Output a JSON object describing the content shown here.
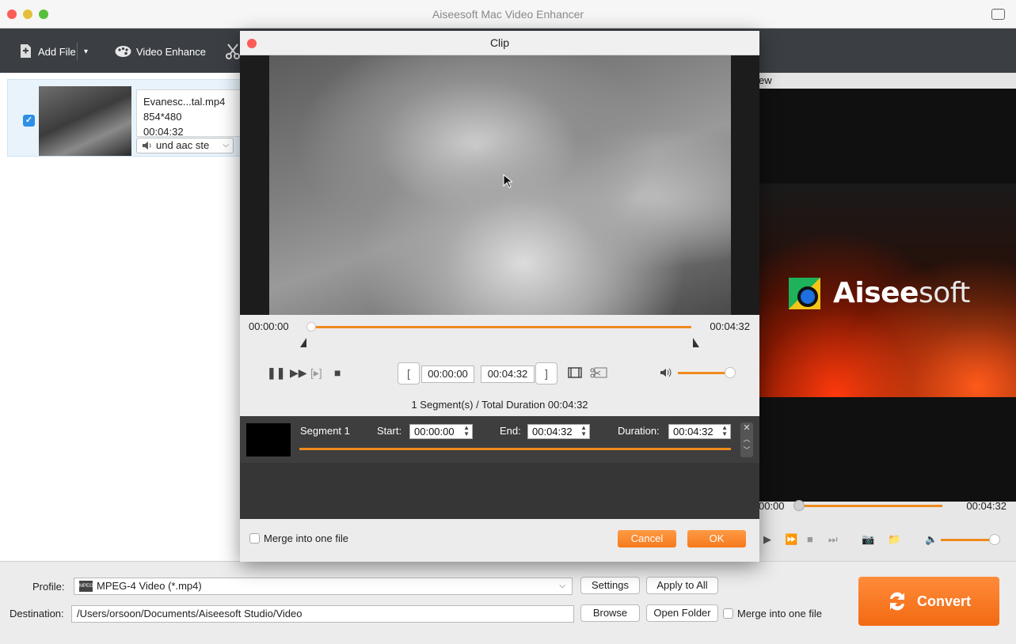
{
  "window": {
    "title": "Aiseesoft Mac Video Enhancer"
  },
  "toolbar": {
    "add_file": "Add File",
    "video_enhance": "Video Enhance"
  },
  "file": {
    "name": "Evanesc...tal.mp4",
    "resolution": "854*480",
    "duration": "00:04:32",
    "audio_track": "und aac ste",
    "checked": true
  },
  "preview": {
    "header": "ew",
    "logo_bold": "Aisee",
    "logo_light": "soft",
    "time_start": "00:00",
    "time_end": "00:04:32"
  },
  "clip": {
    "title": "Clip",
    "time_start": "00:00:00",
    "time_end": "00:04:32",
    "start_field": "00:00:00",
    "end_field": "00:04:32",
    "summary": "1 Segment(s) / Total Duration 00:04:32",
    "segment": {
      "name": "Segment 1",
      "start_label": "Start:",
      "start": "00:00:00",
      "end_label": "End:",
      "end": "00:04:32",
      "duration_label": "Duration:",
      "duration": "00:04:32"
    },
    "merge_label": "Merge into one file",
    "cancel": "Cancel",
    "ok": "OK"
  },
  "bottom": {
    "profile_label": "Profile:",
    "profile_value": "MPEG-4 Video (*.mp4)",
    "settings": "Settings",
    "apply_all": "Apply to All",
    "destination_label": "Destination:",
    "destination_value": "/Users/orsoon/Documents/Aiseesoft Studio/Video",
    "browse": "Browse",
    "open_folder": "Open Folder",
    "merge_label": "Merge into one file",
    "convert": "Convert"
  },
  "colors": {
    "accent": "#f08a1c",
    "toolbar": "#3b3f44",
    "check": "#2e8fe6"
  }
}
